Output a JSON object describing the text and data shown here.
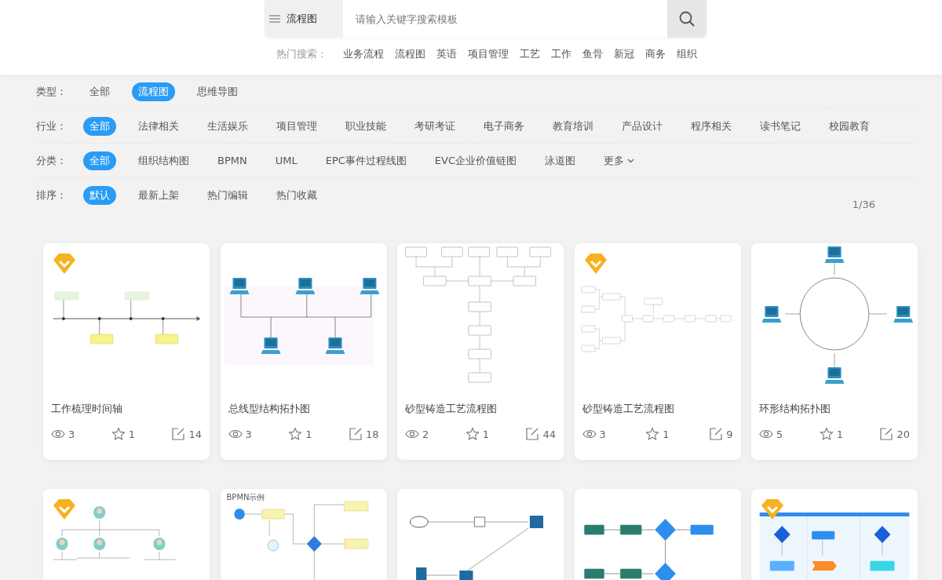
{
  "search": {
    "category": "流程图",
    "placeholder": "请输入关键字搜索模板"
  },
  "hot_search": {
    "label": "热门搜索：",
    "terms": [
      "业务流程",
      "流程图",
      "英语",
      "项目管理",
      "工艺",
      "工作",
      "鱼骨",
      "新冠",
      "商务",
      "组织"
    ]
  },
  "filters": [
    {
      "label": "类型：",
      "options": [
        {
          "text": "全部",
          "selected": false
        },
        {
          "text": "流程图",
          "selected": true
        },
        {
          "text": "思维导图",
          "selected": false
        }
      ]
    },
    {
      "label": "行业：",
      "options": [
        {
          "text": "全部",
          "selected": true
        },
        {
          "text": "法律相关",
          "selected": false
        },
        {
          "text": "生活娱乐",
          "selected": false
        },
        {
          "text": "项目管理",
          "selected": false
        },
        {
          "text": "职业技能",
          "selected": false
        },
        {
          "text": "考研考证",
          "selected": false
        },
        {
          "text": "电子商务",
          "selected": false
        },
        {
          "text": "教育培训",
          "selected": false
        },
        {
          "text": "产品设计",
          "selected": false
        },
        {
          "text": "程序相关",
          "selected": false
        },
        {
          "text": "读书笔记",
          "selected": false
        },
        {
          "text": "校园教育",
          "selected": false
        }
      ]
    },
    {
      "label": "分类：",
      "options": [
        {
          "text": "全部",
          "selected": true
        },
        {
          "text": "组织结构图",
          "selected": false
        },
        {
          "text": "BPMN",
          "selected": false
        },
        {
          "text": "UML",
          "selected": false
        },
        {
          "text": "EPC事件过程线图",
          "selected": false
        },
        {
          "text": "EVC企业价值链图",
          "selected": false
        },
        {
          "text": "泳道图",
          "selected": false
        }
      ],
      "more": "更多"
    },
    {
      "label": "排序：",
      "options": [
        {
          "text": "默认",
          "selected": true
        },
        {
          "text": "最新上架",
          "selected": false
        },
        {
          "text": "热门编辑",
          "selected": false
        },
        {
          "text": "热门收藏",
          "selected": false
        }
      ]
    }
  ],
  "page_indicator": "1/36",
  "cards": [
    {
      "kind": "timeline",
      "premium": true,
      "title": "工作梳理时间轴",
      "views": "3",
      "stars": "1",
      "edits": "14"
    },
    {
      "kind": "bus",
      "premium": false,
      "title": "总线型结构拓扑图",
      "views": "3",
      "stars": "1",
      "edits": "18"
    },
    {
      "kind": "vflow",
      "premium": false,
      "title": "砂型铸造工艺流程图",
      "views": "2",
      "stars": "1",
      "edits": "44"
    },
    {
      "kind": "hflow",
      "premium": true,
      "title": "砂型铸造工艺流程图",
      "views": "3",
      "stars": "1",
      "edits": "9"
    },
    {
      "kind": "ring",
      "premium": false,
      "title": "环形结构拓扑图",
      "views": "5",
      "stars": "1",
      "edits": "20"
    },
    {
      "kind": "org",
      "premium": true
    },
    {
      "kind": "bpmn",
      "premium": false,
      "caption": "BPMN示例"
    },
    {
      "kind": "network",
      "premium": false
    },
    {
      "kind": "process",
      "premium": false
    },
    {
      "kind": "swimlane",
      "premium": true
    }
  ]
}
